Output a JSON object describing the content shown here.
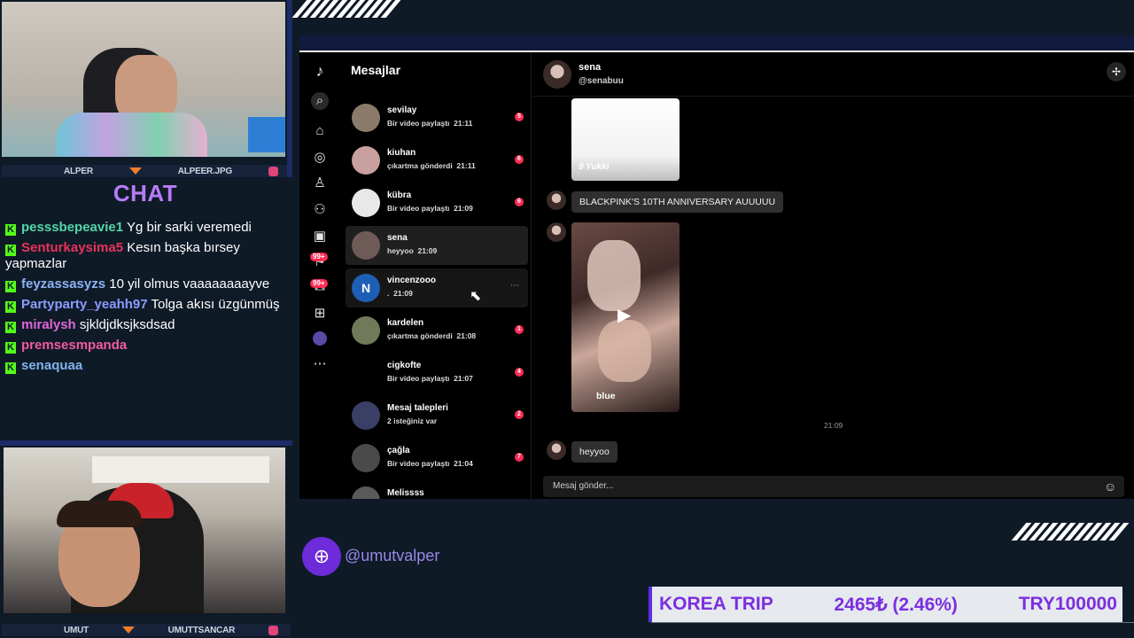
{
  "overlay": {
    "cam1_name": "ALPER",
    "cam1_handle": "ALPEER.JPG",
    "cam2_name": "UMUT",
    "cam2_handle": "UMUTTSANCAR",
    "chat_title": "CHAT",
    "chat_messages": [
      {
        "user": "pesssbepeavie1",
        "color": "#53d6a8",
        "text": "Yg bir sarki veremedi"
      },
      {
        "user": "Senturkaysima5",
        "color": "#e8335a",
        "text": "Kesın başka bırsey yapmazlar"
      },
      {
        "user": "feyzassasyzs",
        "color": "#8bb4f5",
        "text": "10 yil olmus vaaaaaaaayve"
      },
      {
        "user": "Partyparty_yeahh97",
        "color": "#8b9bff",
        "text": "Tolga akısı üzgünmüş"
      },
      {
        "user": "miralysh",
        "color": "#e066d8",
        "text": "sjkldjdksjksdsad"
      },
      {
        "user": "premsesmpanda",
        "color": "#f05aa3",
        "text": ""
      },
      {
        "user": "senaquaa",
        "color": "#7fb2ef",
        "text": ""
      }
    ],
    "social_handle": "@umutvalper",
    "ticker": {
      "label": "KOREA TRIP",
      "amount": "2465₺ (2.46%)",
      "goal": "TRY100000"
    }
  },
  "app": {
    "list_title": "Mesajlar",
    "rail_badges": [
      "99+",
      "99+"
    ],
    "conversations": [
      {
        "name": "sevilay",
        "sub": "Bir video paylaştı",
        "time": "21:11",
        "count": "5",
        "avatar": "#8a7a6a"
      },
      {
        "name": "kiuhan",
        "sub": "çıkartma gönderdi",
        "time": "21:11",
        "count": "6",
        "avatar": "#c9a0a0"
      },
      {
        "name": "kübra",
        "sub": "Bir video paylaştı",
        "time": "21:09",
        "count": "6",
        "avatar": "#e8e8e8"
      },
      {
        "name": "sena",
        "sub": "heyyoo",
        "time": "21:09",
        "count": "",
        "avatar": "#6e5a56"
      },
      {
        "name": "vincenzooo",
        "sub": ".",
        "time": "21:09",
        "count": "",
        "avatar": "#1d5fb5",
        "letter": "N"
      },
      {
        "name": "kardelen",
        "sub": "çıkartma gönderdi",
        "time": "21:08",
        "count": "1",
        "avatar": "#707a5a"
      },
      {
        "name": "cigkofte",
        "sub": "Bir video paylaştı",
        "time": "21:07",
        "count": "4",
        "avatar": "#000000"
      },
      {
        "name": "Mesaj talepleri",
        "sub": "2 isteğiniz var",
        "time": "",
        "count": "2",
        "avatar": "#3b3f66"
      },
      {
        "name": "çağla",
        "sub": "Bir video paylaştı",
        "time": "21:04",
        "count": "7",
        "avatar": "#4a4a4a"
      },
      {
        "name": "Melissss",
        "sub": "",
        "time": "",
        "count": "",
        "avatar": "#5a5a5a"
      }
    ],
    "chat_header": {
      "name": "sena",
      "handle": "@senabuu"
    },
    "messages": {
      "video1_caption": "9 Yukki",
      "text1": "BLACKPINK'S 10TH ANNIVERSARY AUUUUU",
      "video2_caption": "blue",
      "timestamp": "21:09",
      "text2": "heyyoo"
    },
    "input_placeholder": "Mesaj gönder..."
  }
}
